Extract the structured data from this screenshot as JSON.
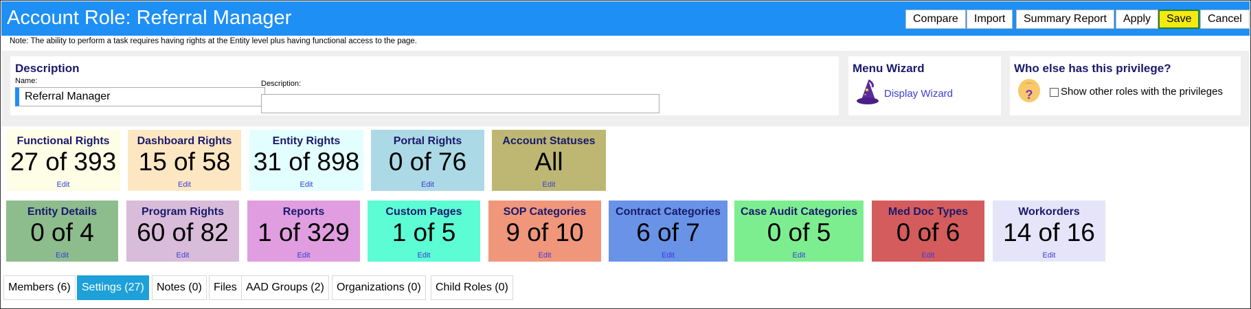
{
  "header": {
    "title": "Account Role: Referral Manager",
    "buttons": [
      "Compare",
      "Import",
      "Summary Report",
      "Apply",
      "Save",
      "Cancel"
    ]
  },
  "note": "Note: The ability to perform a task requires having rights at the Entity level plus having functional access to the page.",
  "description_panel": {
    "heading": "Description",
    "name_label": "Name:",
    "name_value": "Referral Manager",
    "description_label": "Description:",
    "description_value": ""
  },
  "menu_wizard": {
    "heading": "Menu Wizard",
    "link": "Display Wizard"
  },
  "privilege_panel": {
    "heading": "Who else has this privilege?",
    "checkbox_label": "Show other roles with the privileges"
  },
  "tiles_row1": [
    {
      "title": "Functional Rights",
      "value": "27 of 393",
      "edit": "Edit",
      "color": "#fefde6"
    },
    {
      "title": "Dashboard Rights",
      "value": "15 of 58",
      "edit": "Edit",
      "color": "#fde7c2"
    },
    {
      "title": "Entity Rights",
      "value": "31 of 898",
      "edit": "Edit",
      "color": "#e3fefe"
    },
    {
      "title": "Portal Rights",
      "value": "0 of 76",
      "edit": "Edit",
      "color": "#acd9e6"
    },
    {
      "title": "Account Statuses",
      "value": "All",
      "edit": "Edit",
      "color": "#bdb773"
    }
  ],
  "tiles_row2": [
    {
      "title": "Entity Details",
      "value": "0 of 4",
      "edit": "Edit",
      "color": "#8dbd8d"
    },
    {
      "title": "Program Rights",
      "value": "60 of 82",
      "edit": "Edit",
      "color": "#d9bcd9"
    },
    {
      "title": "Reports",
      "value": "1 of 329",
      "edit": "Edit",
      "color": "#e09ee0"
    },
    {
      "title": "Custom Pages",
      "value": "1 of 5",
      "edit": "Edit",
      "color": "#5cfcd4"
    },
    {
      "title": "SOP Categories",
      "value": "9 of 10",
      "edit": "Edit",
      "color": "#ef967b"
    },
    {
      "title": "Contract Categories",
      "value": "6 of 7",
      "edit": "Edit",
      "color": "#6893e7"
    },
    {
      "title": "Case Audit Categories",
      "value": "0 of 5",
      "edit": "Edit",
      "color": "#7dee8f"
    },
    {
      "title": "Med Doc Types",
      "value": "0 of 6",
      "edit": "Edit",
      "color": "#d55c5c"
    },
    {
      "title": "Workorders",
      "value": "14 of 16",
      "edit": "Edit",
      "color": "#e5e4f9"
    }
  ],
  "tabs": [
    {
      "label": "Members (6)",
      "active": false
    },
    {
      "label": "Settings (27)",
      "active": true
    },
    {
      "label": "Notes (0)",
      "active": false
    },
    {
      "label": "Files",
      "active": false
    },
    {
      "label": "AAD Groups (2)",
      "active": false
    },
    {
      "label": "Organizations (0)",
      "active": false
    },
    {
      "label": "Child Roles (0)",
      "active": false
    }
  ]
}
